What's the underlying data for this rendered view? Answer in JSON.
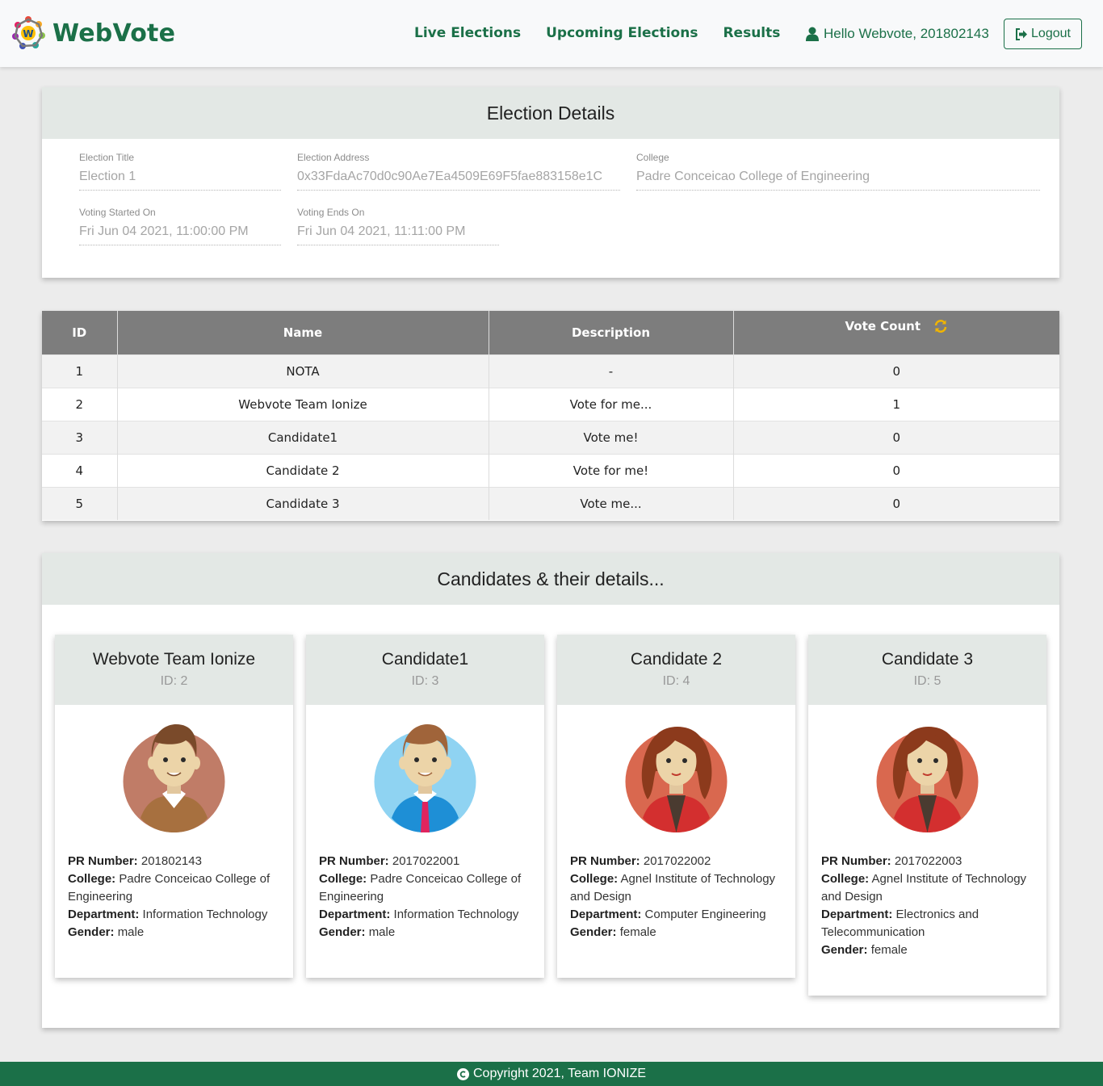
{
  "brand": {
    "name": "WebVote"
  },
  "nav": {
    "links": [
      "Live Elections",
      "Upcoming Elections",
      "Results"
    ],
    "greeting": "Hello Webvote, 201802143",
    "logout": "Logout"
  },
  "details": {
    "header": "Election Details",
    "title_label": "Election Title",
    "title_value": "Election 1",
    "address_label": "Election Address",
    "address_value": "0x33FdaAc70d0c90Ae7Ea4509E69F5fae883158e1C",
    "college_label": "College",
    "college_value": "Padre Conceicao College of Engineering",
    "start_label": "Voting Started On",
    "start_value": "Fri Jun 04 2021, 11:00:00 PM",
    "end_label": "Voting Ends On",
    "end_value": "Fri Jun 04 2021, 11:11:00 PM"
  },
  "table": {
    "columns": [
      "ID",
      "Name",
      "Description",
      "Vote Count"
    ],
    "rows": [
      [
        "1",
        "NOTA",
        "-",
        "0"
      ],
      [
        "2",
        "Webvote Team Ionize",
        "Vote for me...",
        "1"
      ],
      [
        "3",
        "Candidate1",
        "Vote me!",
        "0"
      ],
      [
        "4",
        "Candidate 2",
        "Vote for me!",
        "0"
      ],
      [
        "5",
        "Candidate 3",
        "Vote me...",
        "0"
      ]
    ]
  },
  "candidates": {
    "header": "Candidates & their details...",
    "labels": {
      "pr": "PR Number:",
      "college": "College:",
      "department": "Department:",
      "gender": "Gender:"
    },
    "items": [
      {
        "name": "Webvote Team Ionize",
        "id": "ID: 2",
        "pr": "201802143",
        "college": "Padre Conceicao College of Engineering",
        "department": "Information Technology",
        "gender": "male",
        "avatar": "male-avatar-brown"
      },
      {
        "name": "Candidate1",
        "id": "ID: 3",
        "pr": "2017022001",
        "college": "Padre Conceicao College of Engineering",
        "department": "Information Technology",
        "gender": "male",
        "avatar": "male-avatar-blue"
      },
      {
        "name": "Candidate 2",
        "id": "ID: 4",
        "pr": "2017022002",
        "college": "Agnel Institute of Technology and Design",
        "department": "Computer Engineering",
        "gender": "female",
        "avatar": "female-avatar"
      },
      {
        "name": "Candidate 3",
        "id": "ID: 5",
        "pr": "2017022003",
        "college": "Agnel Institute of Technology and Design",
        "department": "Electronics and Telecommunication",
        "gender": "female",
        "avatar": "female-avatar"
      }
    ]
  },
  "footer": {
    "text": "Copyright 2021, Team IONIZE"
  },
  "colors": {
    "brand": "#1b7048",
    "header_bg": "#e3e8e5",
    "table_head": "#7d7d7d",
    "refresh": "#f0b400"
  }
}
